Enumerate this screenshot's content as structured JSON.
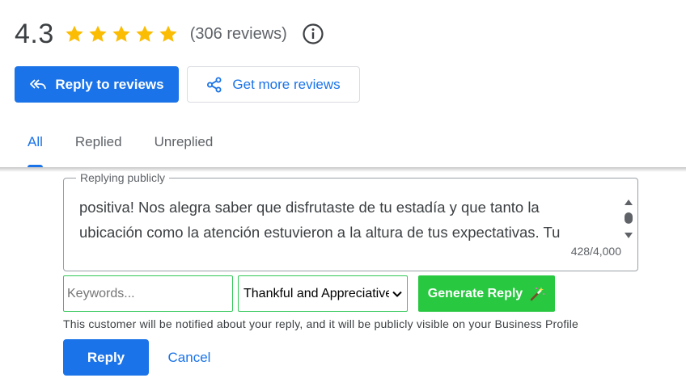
{
  "rating": {
    "value": "4.3",
    "stars_filled": 5,
    "review_count": "(306 reviews)",
    "star_color": "#fbbc04"
  },
  "actions": {
    "reply_to_reviews_label": "Reply to reviews",
    "reply_to_reviews_icon": "reply-all-icon",
    "get_more_reviews_label": "Get more reviews",
    "get_more_reviews_icon": "share-icon"
  },
  "tabs": [
    {
      "label": "All",
      "active": true
    },
    {
      "label": "Replied",
      "active": false
    },
    {
      "label": "Unreplied",
      "active": false
    }
  ],
  "reply_box": {
    "legend": "Replying publicly",
    "text_lines": [
      "positiva! Nos alegra saber que disfrutaste de tu estadía y que tanto la",
      "ubicación como la atención estuvieron a la altura de tus expectativas. Tu"
    ],
    "char_count": "428/4,000"
  },
  "controls": {
    "keywords_placeholder": "Keywords...",
    "keywords_value": "",
    "tone_selected": "Thankful and Appreciative",
    "generate_label": "Generate Reply",
    "generate_icon": "magic-wand-icon",
    "accent_green": "#28c840"
  },
  "notice": "This customer will be notified about your reply, and it will be publicly visible on your Business Profile",
  "footer": {
    "reply_label": "Reply",
    "cancel_label": "Cancel"
  },
  "colors": {
    "primary": "#1a73e8",
    "text_secondary": "#5f6368"
  }
}
